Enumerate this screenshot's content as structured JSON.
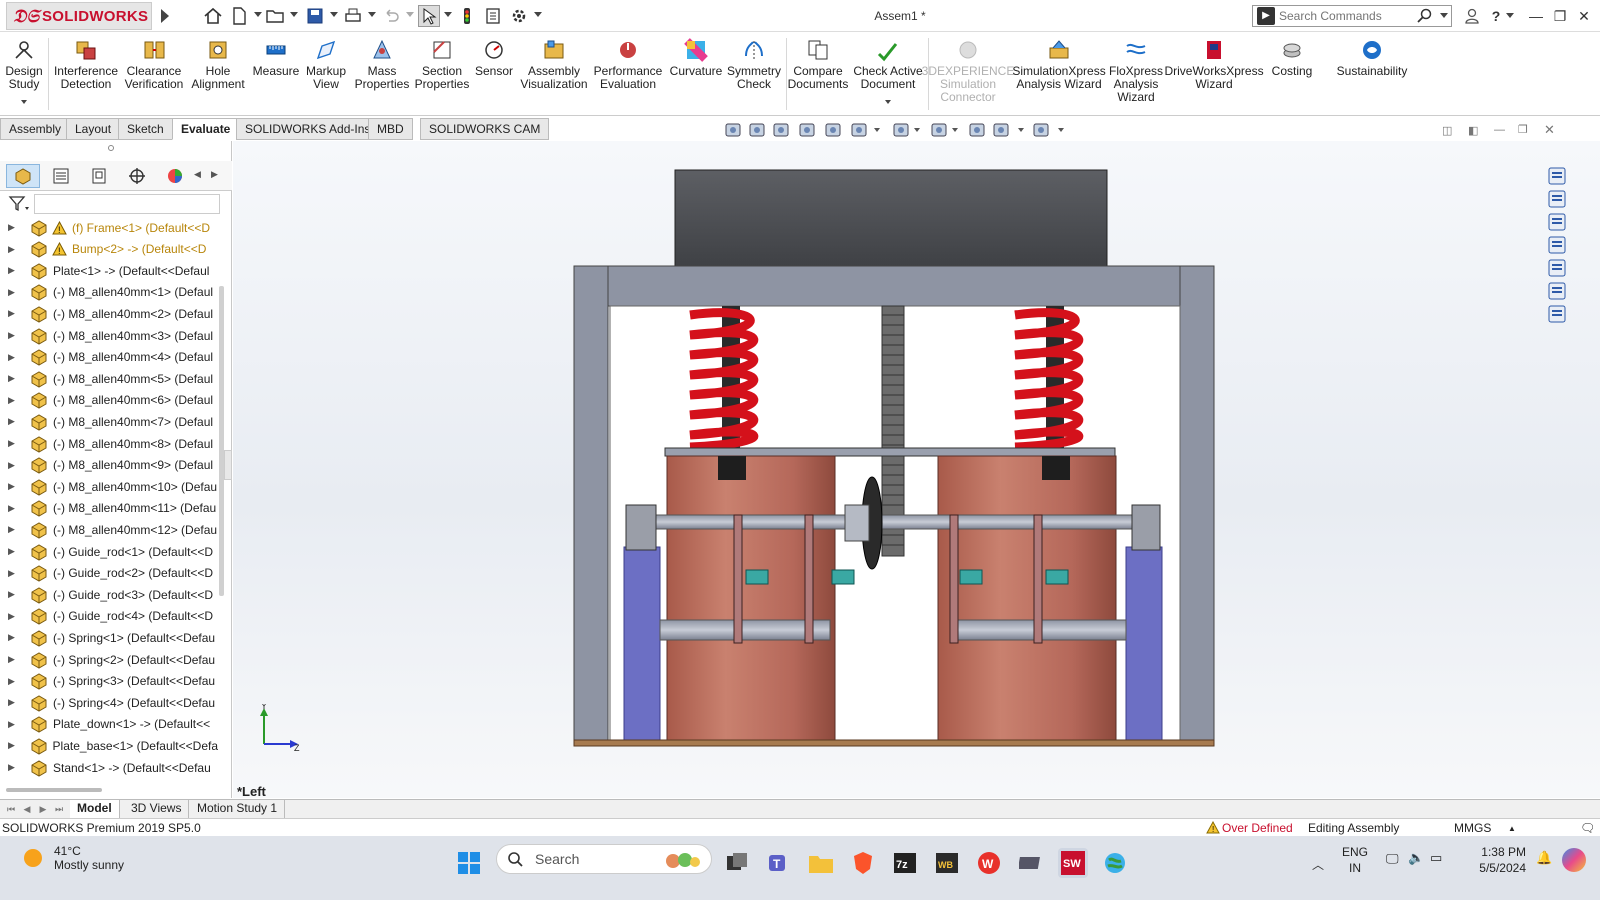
{
  "app": {
    "brand": "SOLIDWORKS",
    "doc_title": "Assem1 *",
    "search_placeholder": "Search Commands"
  },
  "ribbon": [
    {
      "name": "design-study",
      "label": [
        "Design",
        "Study"
      ],
      "icon": "design-study-icon"
    },
    {
      "name": "interference-detection",
      "label": [
        "Interference",
        "Detection"
      ],
      "icon": "interference-icon"
    },
    {
      "name": "clearance-verification",
      "label": [
        "Clearance",
        "Verification"
      ],
      "icon": "clearance-icon"
    },
    {
      "name": "hole-alignment",
      "label": [
        "Hole",
        "Alignment"
      ],
      "icon": "hole-alignment-icon"
    },
    {
      "name": "measure",
      "label": [
        "Measure"
      ],
      "icon": "measure-icon"
    },
    {
      "name": "markup-view",
      "label": [
        "Markup",
        "View"
      ],
      "icon": "markup-icon"
    },
    {
      "name": "mass-properties",
      "label": [
        "Mass",
        "Properties"
      ],
      "icon": "mass-properties-icon"
    },
    {
      "name": "section-properties",
      "label": [
        "Section",
        "Properties"
      ],
      "icon": "section-properties-icon"
    },
    {
      "name": "sensor",
      "label": [
        "Sensor"
      ],
      "icon": "sensor-icon"
    },
    {
      "name": "assembly-visualization",
      "label": [
        "Assembly",
        "Visualization"
      ],
      "icon": "assembly-visualization-icon"
    },
    {
      "name": "performance-evaluation",
      "label": [
        "Performance",
        "Evaluation"
      ],
      "icon": "performance-icon"
    },
    {
      "name": "curvature",
      "label": [
        "Curvature"
      ],
      "icon": "curvature-icon"
    },
    {
      "name": "symmetry-check",
      "label": [
        "Symmetry",
        "Check"
      ],
      "icon": "symmetry-icon"
    },
    {
      "name": "compare-documents",
      "label": [
        "Compare",
        "Documents"
      ],
      "icon": "compare-icon"
    },
    {
      "name": "check-active-document",
      "label": [
        "Check Active",
        "Document"
      ],
      "icon": "check-document-icon"
    },
    {
      "name": "3dexperience-simulation-connector",
      "label": [
        "3DEXPERIENCE",
        "Simulation",
        "Connector"
      ],
      "icon": "3dexperience-icon",
      "disabled": true
    },
    {
      "name": "simulationxpress-wizard",
      "label": [
        "SimulationXpress",
        "Analysis Wizard"
      ],
      "icon": "simulationxpress-icon"
    },
    {
      "name": "floxpress-wizard",
      "label": [
        "FloXpress",
        "Analysis",
        "Wizard"
      ],
      "icon": "floxpress-icon"
    },
    {
      "name": "driveworksxpress-wizard",
      "label": [
        "DriveWorksXpress",
        "Wizard"
      ],
      "icon": "driveworks-icon"
    },
    {
      "name": "costing",
      "label": [
        "Costing"
      ],
      "icon": "costing-icon"
    },
    {
      "name": "sustainability",
      "label": [
        "Sustainability"
      ],
      "icon": "sustainability-icon"
    }
  ],
  "command_tabs": [
    "Assembly",
    "Layout",
    "Sketch",
    "Evaluate",
    "SOLIDWORKS Add-Ins",
    "MBD",
    "SOLIDWORKS CAM"
  ],
  "active_command_tab": "Evaluate",
  "tree_items": [
    {
      "label": "(f) Frame<1> (Default<<D",
      "warning": true
    },
    {
      "label": "Bump<2> -> (Default<<D",
      "warning": true
    },
    {
      "label": "Plate<1> -> (Default<<Defaul"
    },
    {
      "label": "(-) M8_allen40mm<1> (Defaul"
    },
    {
      "label": "(-) M8_allen40mm<2> (Defaul"
    },
    {
      "label": "(-) M8_allen40mm<3> (Defaul"
    },
    {
      "label": "(-) M8_allen40mm<4> (Defaul"
    },
    {
      "label": "(-) M8_allen40mm<5> (Defaul"
    },
    {
      "label": "(-) M8_allen40mm<6> (Defaul"
    },
    {
      "label": "(-) M8_allen40mm<7> (Defaul"
    },
    {
      "label": "(-) M8_allen40mm<8> (Defaul"
    },
    {
      "label": "(-) M8_allen40mm<9> (Defaul"
    },
    {
      "label": "(-) M8_allen40mm<10> (Defau"
    },
    {
      "label": "(-) M8_allen40mm<11> (Defau"
    },
    {
      "label": "(-) M8_allen40mm<12> (Defau"
    },
    {
      "label": "(-) Guide_rod<1> (Default<<D"
    },
    {
      "label": "(-) Guide_rod<2> (Default<<D"
    },
    {
      "label": "(-) Guide_rod<3> (Default<<D"
    },
    {
      "label": "(-) Guide_rod<4> (Default<<D"
    },
    {
      "label": "(-) Spring<1> (Default<<Defau"
    },
    {
      "label": "(-) Spring<2> (Default<<Defau"
    },
    {
      "label": "(-) Spring<3> (Default<<Defau"
    },
    {
      "label": "(-) Spring<4> (Default<<Defau"
    },
    {
      "label": "Plate_down<1> -> (Default<<"
    },
    {
      "label": "Plate_base<1> (Default<<Defa"
    },
    {
      "label": "Stand<1> -> (Default<<Defau"
    }
  ],
  "view_label": "*Left",
  "triad": {
    "x": "Z",
    "y": "Y"
  },
  "bottom_tabs": [
    "Model",
    "3D Views",
    "Motion Study 1"
  ],
  "status": {
    "product": "SOLIDWORKS Premium 2019 SP5.0",
    "defined_state": "Over Defined",
    "mode": "Editing Assembly",
    "units": "MMGS"
  },
  "taskbar": {
    "weather_temp": "41°C",
    "weather_desc": "Mostly sunny",
    "search": "Search",
    "lang1": "ENG",
    "lang2": "IN",
    "time": "1:38 PM",
    "date": "5/5/2024"
  },
  "colors": {
    "brand_red": "#c8102e",
    "spring_red": "#d4111b",
    "cylinder": "#c77b6a",
    "stand_blue": "#6c6fc4",
    "frame_grey": "#8e94a3"
  }
}
